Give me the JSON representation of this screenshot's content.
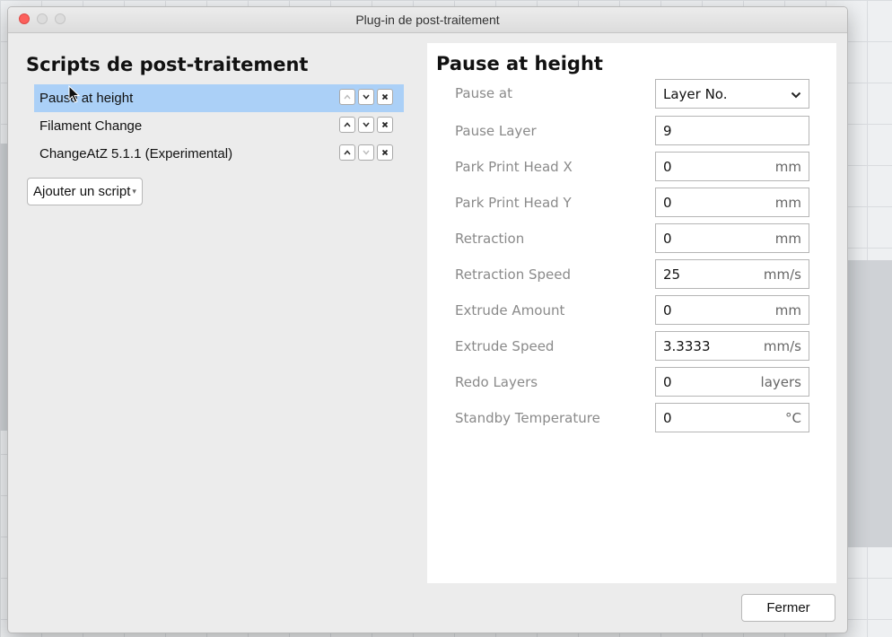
{
  "window": {
    "title": "Plug-in de post-traitement"
  },
  "left": {
    "heading": "Scripts de post-traitement",
    "scripts": [
      {
        "name": "Pause at height",
        "selected": true,
        "up_enabled": false,
        "down_enabled": true
      },
      {
        "name": "Filament Change",
        "selected": false,
        "up_enabled": true,
        "down_enabled": true
      },
      {
        "name": "ChangeAtZ 5.1.1 (Experimental)",
        "selected": false,
        "up_enabled": true,
        "down_enabled": false
      }
    ],
    "add_script_label": "Ajouter un script"
  },
  "right": {
    "heading": "Pause at height",
    "settings": [
      {
        "label": "Pause at",
        "value": "Layer No.",
        "unit": "",
        "type": "select"
      },
      {
        "label": "Pause Layer",
        "value": "9",
        "unit": "",
        "type": "input"
      },
      {
        "label": "Park Print Head X",
        "value": "0",
        "unit": "mm",
        "type": "input"
      },
      {
        "label": "Park Print Head Y",
        "value": "0",
        "unit": "mm",
        "type": "input"
      },
      {
        "label": "Retraction",
        "value": "0",
        "unit": "mm",
        "type": "input"
      },
      {
        "label": "Retraction Speed",
        "value": "25",
        "unit": "mm/s",
        "type": "input"
      },
      {
        "label": "Extrude Amount",
        "value": "0",
        "unit": "mm",
        "type": "input"
      },
      {
        "label": "Extrude Speed",
        "value": "3.3333",
        "unit": "mm/s",
        "type": "input"
      },
      {
        "label": "Redo Layers",
        "value": "0",
        "unit": "layers",
        "type": "input"
      },
      {
        "label": "Standby Temperature",
        "value": "0",
        "unit": "°C",
        "type": "input"
      }
    ]
  },
  "footer": {
    "close_label": "Fermer"
  },
  "colors": {
    "selection": "#abd0f7",
    "close_dot": "#fc605c",
    "label": "#8a8a8a"
  }
}
